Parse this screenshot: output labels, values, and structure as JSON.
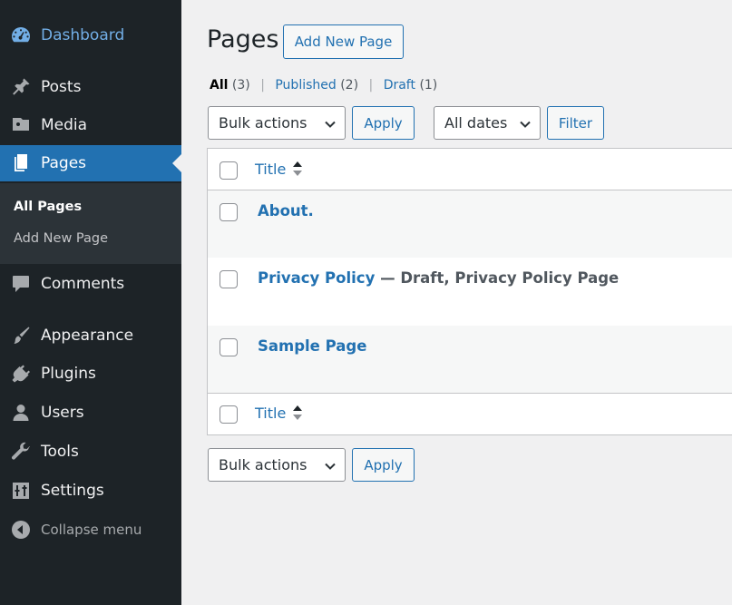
{
  "sidebar": {
    "dashboard": "Dashboard",
    "posts": "Posts",
    "media": "Media",
    "pages": "Pages",
    "sub_all_pages": "All Pages",
    "sub_add_new": "Add New Page",
    "comments": "Comments",
    "appearance": "Appearance",
    "plugins": "Plugins",
    "users": "Users",
    "tools": "Tools",
    "settings": "Settings",
    "collapse": "Collapse menu"
  },
  "header": {
    "title": "Pages",
    "add_new": "Add New Page"
  },
  "filters": {
    "all_label": "All",
    "all_count": "(3)",
    "published_label": "Published",
    "published_count": "(2)",
    "draft_label": "Draft",
    "draft_count": "(1)",
    "separator": "|"
  },
  "toolbar_top": {
    "bulk_actions": "Bulk actions",
    "apply": "Apply",
    "all_dates": "All dates",
    "filter": "Filter"
  },
  "table": {
    "column_title": "Title",
    "rows": [
      {
        "title": "About.",
        "state": ""
      },
      {
        "title": "Privacy Policy",
        "state": " — Draft, Privacy Policy Page"
      },
      {
        "title": "Sample Page",
        "state": ""
      }
    ]
  },
  "toolbar_bottom": {
    "bulk_actions": "Bulk actions",
    "apply": "Apply"
  },
  "colors": {
    "sidebar_bg": "#1d2327",
    "submenu_bg": "#2c3338",
    "accent": "#2271b1",
    "link": "#2271b1",
    "page_bg": "#f0f0f1",
    "alt_row": "#f6f7f7"
  }
}
